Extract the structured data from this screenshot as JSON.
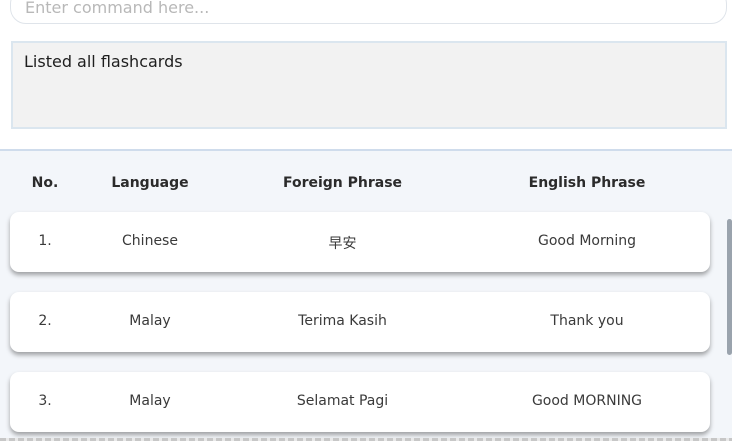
{
  "command": {
    "placeholder": "Enter command here..."
  },
  "result": {
    "message": "Listed all flashcards"
  },
  "table": {
    "headers": {
      "no": "No.",
      "language": "Language",
      "foreign": "Foreign Phrase",
      "english": "English Phrase"
    },
    "rows": [
      {
        "no": "1.",
        "language": "Chinese",
        "foreign": "早安",
        "english": "Good Morning"
      },
      {
        "no": "2.",
        "language": "Malay",
        "foreign": "Terima Kasih",
        "english": "Thank you"
      },
      {
        "no": "3.",
        "language": "Malay",
        "foreign": "Selamat Pagi",
        "english": "Good MORNING"
      }
    ]
  },
  "colors": {
    "panel_background": "#f3f6fa",
    "result_background": "#f2f2f2",
    "card_background": "#ffffff",
    "scrollbar": "#9aa3ad"
  }
}
